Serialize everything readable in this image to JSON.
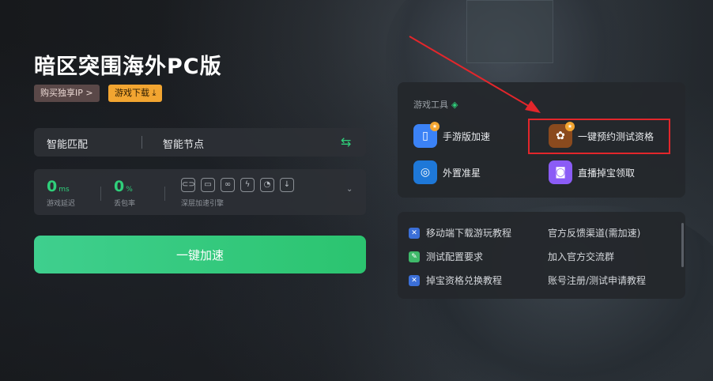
{
  "game": {
    "title": "暗区突围海外PC版",
    "buy_ip_label": "购买独享IP >",
    "download_label": "游戏下载 ⤓"
  },
  "node_bar": {
    "mode_label": "智能匹配",
    "node_label": "智能节点",
    "swap_icon": "⇆"
  },
  "stats": {
    "latency_value": "0",
    "latency_unit": "ms",
    "latency_label": "游戏延迟",
    "loss_value": "0",
    "loss_unit": "%",
    "loss_label": "丢包率",
    "engine_label": "深层加速引擎",
    "engine_icons": [
      "link-icon",
      "screen-icon",
      "loop-icon",
      "bolt-icon",
      "timer-icon",
      "download-icon"
    ],
    "expand_icon": "⌄"
  },
  "accelerate_button": "一键加速",
  "tools": {
    "title": "游戏工具",
    "items": [
      {
        "label": "手游版加速",
        "icon": "mobile-icon",
        "color": "#3b82f6"
      },
      {
        "label": "一键预约测试资格",
        "icon": "calendar-icon",
        "color": "#8a4a1e"
      },
      {
        "label": "外置准星",
        "icon": "crosshair-icon",
        "color": "#1e78d8"
      },
      {
        "label": "直播掉宝领取",
        "icon": "twitch-icon",
        "color": "#8b5cf6"
      }
    ]
  },
  "links": {
    "items": [
      {
        "label": "移动端下载游玩教程",
        "icon": "tutorial-icon",
        "color": "#3b6fd8"
      },
      {
        "label": "官方反馈渠道(需加速)"
      },
      {
        "label": "测试配置要求",
        "icon": "edit-icon",
        "color": "#3fb96a"
      },
      {
        "label": "加入官方交流群"
      },
      {
        "label": "掉宝资格兑换教程",
        "icon": "tutorial-icon",
        "color": "#3b6fd8"
      },
      {
        "label": "账号注册/测试申请教程"
      }
    ]
  },
  "colors": {
    "accent": "#2fcf7a",
    "highlight": "#e3262b",
    "download_tag": "#f2a531"
  }
}
